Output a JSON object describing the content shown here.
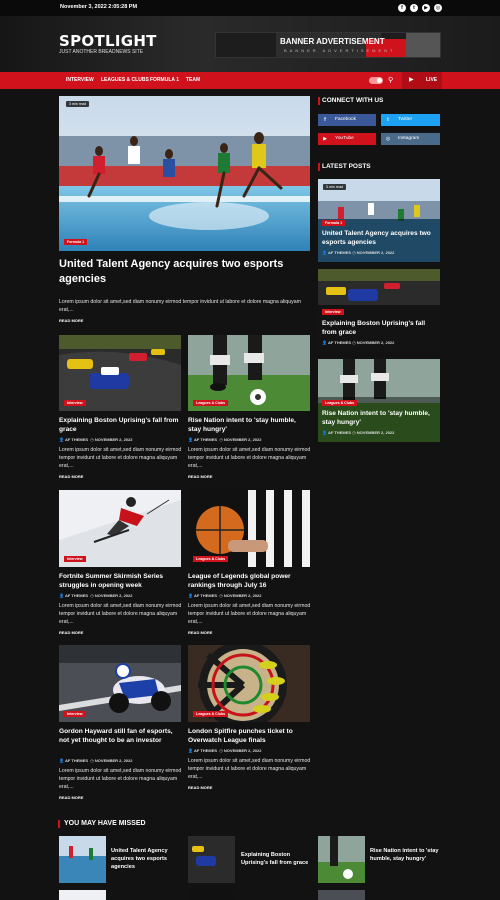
{
  "topbar": {
    "date": "November 3, 2022 2:05:28 PM",
    "social": [
      {
        "icon": "facebook-icon",
        "glyph": "f"
      },
      {
        "icon": "twitter-icon",
        "glyph": "t"
      },
      {
        "icon": "youtube-icon",
        "glyph": "▶"
      },
      {
        "icon": "instagram-icon",
        "glyph": "◎"
      }
    ]
  },
  "header": {
    "logo": "SPOTLIGHT",
    "tagline": "JUST ANOTHER BREADNEWS SITE",
    "banner_title": "BANNER ADVERTISEMENT",
    "banner_subtitle": "BANNER ADVERTISEMENT"
  },
  "nav": {
    "items": [
      "INTERVIEW",
      "LEAGUES & CLUBS",
      "FORMULA 1",
      "TEAM"
    ],
    "live": "LIVE"
  },
  "featured": {
    "read_time": "3 min read",
    "category": "Formula 1",
    "title": "United Talent Agency acquires two esports agencies",
    "excerpt": "Lorem ipsum dolor sit amet,sed diam nonumy eirmod tempor invidunt ut labore et dolore magna aliquyam erat,...",
    "read_more": "READ MORE"
  },
  "grid": [
    {
      "category": "Interview",
      "title": "Explaining Boston Uprising's fall from grace",
      "author": "AF THEMES",
      "date": "NOVEMBER 2, 2022",
      "excerpt": "Lorem ipsum dolor sit amet,sed diam nonumy eirmod tempor invidunt ut labore et dolore magna aliquyam erat,...",
      "read_more": "READ MORE"
    },
    {
      "category": "Leagues & Clubs",
      "title": "Rise Nation intent to 'stay humble, stay hungry'",
      "author": "AF THEMES",
      "date": "NOVEMBER 2, 2022",
      "excerpt": "Lorem ipsum dolor sit amet,sed diam nonumy eirmod tempor invidunt ut labore et dolore magna aliquyam erat,...",
      "read_more": "READ MORE"
    },
    {
      "category": "Interview",
      "title": "Fortnite Summer Skirmish Series struggles in opening week",
      "author": "AF THEMES",
      "date": "NOVEMBER 2, 2022",
      "excerpt": "Lorem ipsum dolor sit amet,sed diam nonumy eirmod tempor invidunt ut labore et dolore magna aliquyam erat,...",
      "read_more": "READ MORE"
    },
    {
      "category": "Leagues & Clubs",
      "title": "League of Legends global power rankings through July 16",
      "author": "AF THEMES",
      "date": "NOVEMBER 2, 2022",
      "excerpt": "Lorem ipsum dolor sit amet,sed diam nonumy eirmod tempor invidunt ut labore et dolore magna aliquyam erat,...",
      "read_more": "READ MORE"
    },
    {
      "category": "Interview",
      "title": "Gordon Hayward still fan of esports, not yet thought to be an investor",
      "author": "AF THEMES",
      "date": "NOVEMBER 2, 2022",
      "excerpt": "Lorem ipsum dolor sit amet,sed diam nonumy eirmod tempor invidunt ut labore et dolore magna aliquyam erat,...",
      "read_more": "READ MORE"
    },
    {
      "category": "Leagues & Clubs",
      "title": "London Spitfire punches ticket to Overwatch League finals",
      "author": "AF THEMES",
      "date": "NOVEMBER 2, 2022",
      "excerpt": "Lorem ipsum dolor sit amet,sed diam nonumy eirmod tempor invidunt ut labore et dolore magna aliquyam erat,...",
      "read_more": "READ MORE"
    }
  ],
  "sidebar": {
    "connect_title": "CONNECT WITH US",
    "social": [
      {
        "label": "Facebook",
        "color": "#3b5998",
        "glyph": "f"
      },
      {
        "label": "Twitter",
        "color": "#1da1f2",
        "glyph": "t"
      },
      {
        "label": "YouTube",
        "color": "#d0121c",
        "glyph": "▶"
      },
      {
        "label": "Instagram",
        "color": "#4a6a8a",
        "glyph": "◎"
      }
    ],
    "latest_title": "LATEST POSTS",
    "latest": [
      {
        "read_time": "3 min read",
        "category": "Formula 1",
        "title": "United Talent Agency acquires two esports agencies",
        "author": "AF THEMES",
        "date": "NOVEMBER 2, 2022"
      },
      {
        "category": "Interview",
        "title": "Explaining Boston Uprising's fall from grace",
        "author": "AF THEMES",
        "date": "NOVEMBER 2, 2022"
      },
      {
        "category": "Leagues & Clubs",
        "title": "Rise Nation intent to 'stay humble, stay hungry'",
        "author": "AF THEMES",
        "date": "NOVEMBER 2, 2022"
      }
    ]
  },
  "missed": {
    "title": "YOU MAY HAVE MISSED",
    "items": [
      "United Talent Agency acquires two esports agencies",
      "Explaining Boston Uprising's fall from grace",
      "Rise Nation intent to 'stay humble, stay hungry'"
    ]
  },
  "colors": {
    "accent": "#d0121c",
    "background": "#121212"
  }
}
